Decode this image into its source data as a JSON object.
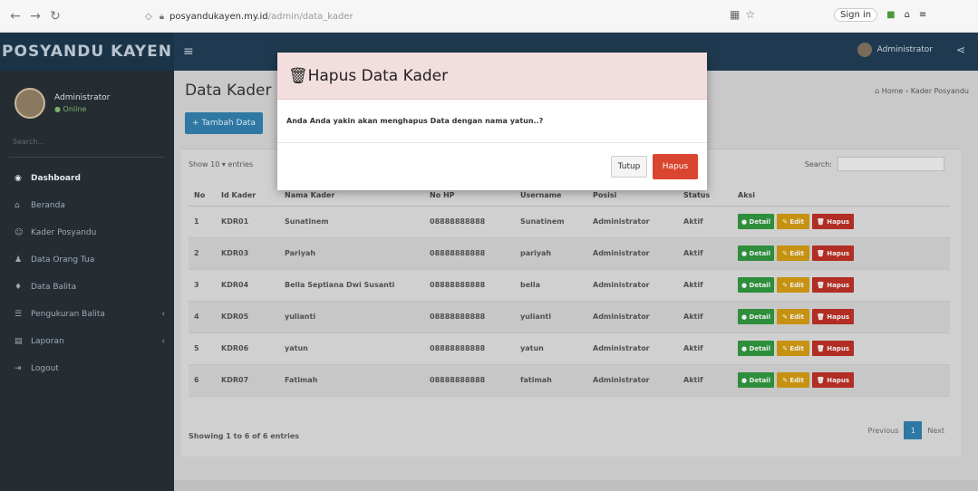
{
  "browser": {
    "domain": "posyandukayen.my.id",
    "path": "/admin/data_kader",
    "signin_label": "Sign in"
  },
  "app": {
    "brand": "POSYANDU KAYEN",
    "header_user": "Administrator"
  },
  "sidebar": {
    "user_name": "Administrator",
    "user_status": "● Online",
    "search_placeholder": "Search...",
    "items": [
      {
        "label": "Dashboard",
        "icon": "dashboard-icon",
        "glyph": "◉"
      },
      {
        "label": "Beranda",
        "icon": "home-icon",
        "glyph": "⌂"
      },
      {
        "label": "Kader Posyandu",
        "icon": "users-icon",
        "glyph": "☺"
      },
      {
        "label": "Data Orang Tua",
        "icon": "user-icon",
        "glyph": "♟"
      },
      {
        "label": "Data Balita",
        "icon": "child-icon",
        "glyph": "♦"
      },
      {
        "label": "Pengukuran Balita",
        "icon": "scale-icon",
        "glyph": "☰"
      },
      {
        "label": "Laporan",
        "icon": "report-icon",
        "glyph": "▤"
      },
      {
        "label": "Logout",
        "icon": "logout-icon",
        "glyph": "⇥"
      }
    ]
  },
  "page": {
    "title": "Data Kader Posyandu",
    "breadcrumb": "⌂ Home › Kader Posyandu",
    "add_button": "+ Tambah Data",
    "show_entries": "Show 10 ▾ entries",
    "search_label": "Search:",
    "showing": "Showing 1 to 6 of 6 entries",
    "prev": "Previous",
    "current_page": "1",
    "next": "Next"
  },
  "table": {
    "headers": [
      "No",
      "Id Kader",
      "Nama Kader",
      "No HP",
      "Username",
      "Posisi",
      "Status",
      "Aksi"
    ],
    "rows": [
      [
        "1",
        "KDR01",
        "Sunatinem",
        "08888888888",
        "Sunatinem",
        "Administrator",
        "Aktif"
      ],
      [
        "2",
        "KDR03",
        "Pariyah",
        "08888888888",
        "pariyah",
        "Administrator",
        "Aktif"
      ],
      [
        "3",
        "KDR04",
        "Bella Septiana Dwi Susanti",
        "08888888888",
        "bella",
        "Administrator",
        "Aktif"
      ],
      [
        "4",
        "KDR05",
        "yulianti",
        "08888888888",
        "yulianti",
        "Administrator",
        "Aktif"
      ],
      [
        "5",
        "KDR06",
        "yatun",
        "08888888888",
        "yatun",
        "Administrator",
        "Aktif"
      ],
      [
        "6",
        "KDR07",
        "Fatimah",
        "08888888888",
        "fatimah",
        "Administrator",
        "Aktif"
      ]
    ],
    "btn_detail": "● Detail",
    "btn_edit": "✎ Edit",
    "btn_delete": "🗑 Hapus"
  },
  "modal": {
    "title": "🗑Hapus Data Kader",
    "message": "Anda Anda yakin akan menghapus Data dengan nama yatun..?",
    "close_label": "Tutup",
    "delete_label": "Hapus"
  },
  "colors": {
    "header": "#1f3a50",
    "sidebar": "#252d33",
    "modal_danger": "#d9452e",
    "modal_head": "#f3dede",
    "btn_detail": "#2e8e3b",
    "btn_edit": "#c79211",
    "btn_delete": "#b22d24"
  }
}
